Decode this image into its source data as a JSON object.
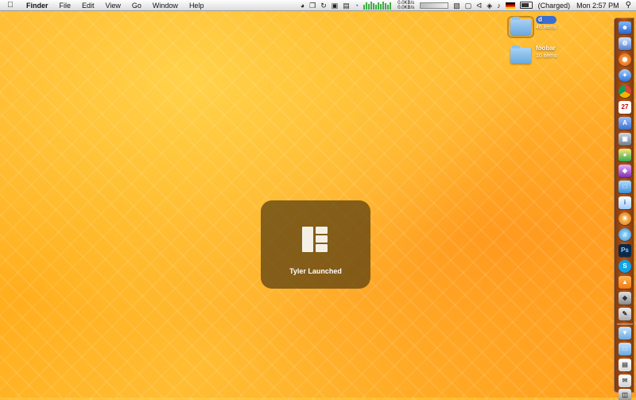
{
  "menubar": {
    "items": [
      "Finder",
      "File",
      "Edit",
      "View",
      "Go",
      "Window",
      "Help"
    ],
    "status": {
      "net_up": "0.0KB/s",
      "net_down": "0.0KB/s",
      "battery": "(Charged)",
      "clock": "Mon 2:57 PM"
    }
  },
  "desktop": {
    "items": [
      {
        "name": "d",
        "count": "46 items"
      },
      {
        "name": "foobar",
        "count": "10 items"
      }
    ]
  },
  "hud": {
    "label": "Tyler Launched"
  },
  "colors": {
    "hud_bg": "#553c0f",
    "dock": "#b5561a",
    "selection": "#3a6fd1"
  }
}
